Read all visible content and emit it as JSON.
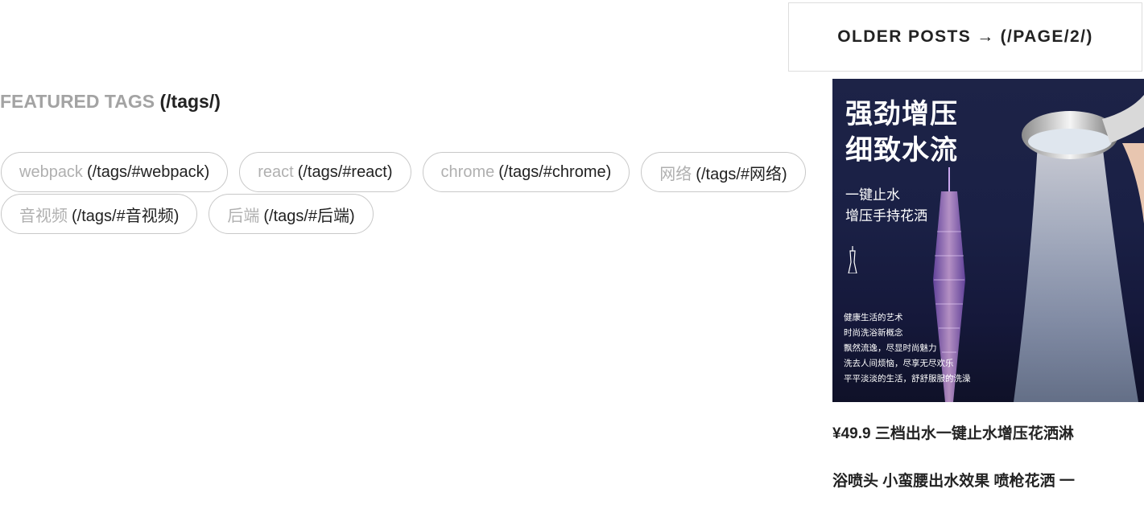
{
  "pager": {
    "older_posts_label": "OLDER POSTS",
    "arrow": "→",
    "href": "(/PAGE/2/)"
  },
  "featured_tags": {
    "heading": "FEATURED TAGS",
    "href": "(/tags/)",
    "tags": [
      {
        "name": "webpack",
        "href": "(/tags/#webpack)"
      },
      {
        "name": "react",
        "href": "(/tags/#react)"
      },
      {
        "name": "chrome",
        "href": "(/tags/#chrome)"
      },
      {
        "name": "网络",
        "href": "(/tags/#网络)"
      },
      {
        "name": "音视频",
        "href": "(/tags/#音视频)"
      },
      {
        "name": "后端",
        "href": "(/tags/#后端)"
      }
    ]
  },
  "ad": {
    "headline_1": "强劲增压",
    "headline_2": "细致水流",
    "sub_1": "一键止水",
    "sub_2": "增压手持花洒",
    "desc": [
      "健康生活的艺术",
      "时尚洗浴新概念",
      "飘然流逸，尽显时尚魅力",
      "洗去人间烦恼，尽享无尽欢乐",
      "平平淡淡的生活，舒舒服服的洗澡"
    ],
    "caption_line_1": "¥49.9 三档出水一键止水增压花洒淋",
    "caption_line_2": "浴喷头 小蛮腰出水效果 喷枪花洒 一"
  }
}
